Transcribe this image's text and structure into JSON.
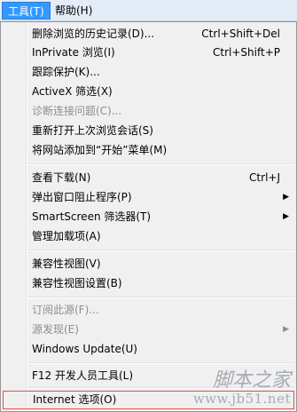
{
  "menubar": {
    "tools": "工具(T)",
    "help": "帮助(H)"
  },
  "menu": {
    "delete_history": "删除浏览的历史记录(D)...",
    "delete_history_shortcut": "Ctrl+Shift+Del",
    "inprivate": "InPrivate 浏览(I)",
    "inprivate_shortcut": "Ctrl+Shift+P",
    "tracking_protection": "跟踪保护(K)...",
    "activex_filter": "ActiveX 筛选(X)",
    "diagnose": "诊断连接问题(C)...",
    "reopen_session": "重新打开上次浏览会话(S)",
    "add_to_start": "将网站添加到“开始”菜单(M)",
    "view_downloads": "查看下载(N)",
    "view_downloads_shortcut": "Ctrl+J",
    "popup_blocker": "弹出窗口阻止程序(P)",
    "smartscreen": "SmartScreen 筛选器(T)",
    "manage_addons": "管理加载项(A)",
    "compat_view": "兼容性视图(V)",
    "compat_settings": "兼容性视图设置(B)",
    "subscribe_feed": "订阅此源(F)...",
    "feed_discovery": "源发现(E)",
    "windows_update": "Windows Update(U)",
    "f12_tools": "F12 开发人员工具(L)",
    "internet_options": "Internet 选项(O)"
  },
  "watermark": {
    "line1": "脚本之家",
    "line2": "www.jb51.net"
  }
}
